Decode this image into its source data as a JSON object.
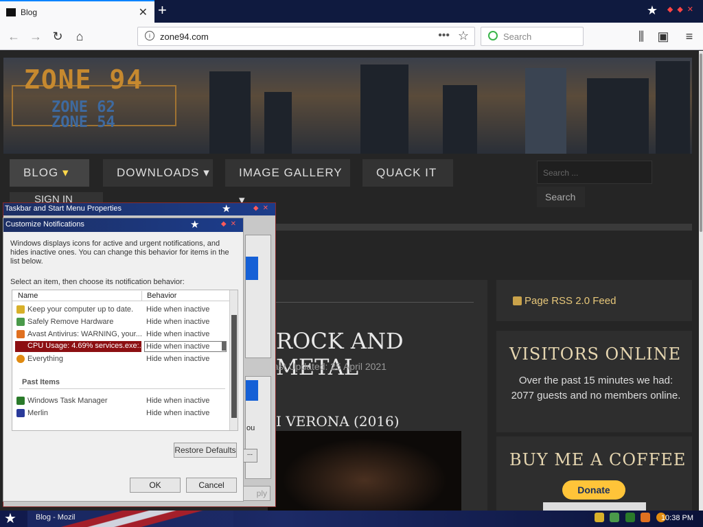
{
  "browser": {
    "tab_title": "Blog",
    "tab_close": "✕",
    "new_tab": "+",
    "url": "zone94.com",
    "page_actions": "•••",
    "search_placeholder": "Search"
  },
  "site": {
    "logo_main": "ZONE 94",
    "logo_sub1": "ZONE 62",
    "logo_sub2": "ZONE 54",
    "nav": [
      {
        "label": "BLOG",
        "caret": true
      },
      {
        "label": "DOWNLOADS",
        "caret": true
      },
      {
        "label": "IMAGE GALLERY",
        "caret": true
      },
      {
        "label": "QUACK IT",
        "caret": false
      }
    ],
    "signin_label": "SIGN IN",
    "search_placeholder": "Search ...",
    "search_button": "Search",
    "main_heading": "ROCK AND METAL",
    "last_updated": "ast Updated: 25 April 2021",
    "post_title": "I VERONA (2016)",
    "rss_label": "Page RSS 2.0 Feed",
    "visitors_title": "VISITORS ONLINE",
    "visitors_text": "Over the past 15 minutes we had: 2077 guests and no members online.",
    "coffee_title": "BUY ME A COFFEE",
    "donate_label": "Donate"
  },
  "outer_dialog": {
    "title": "Taskbar and Start Menu Properties",
    "partial_text": "ou",
    "dots_button": "...",
    "apply_label": "ply"
  },
  "dialog": {
    "title": "Customize Notifications",
    "description": "Windows displays icons for active and urgent notifications, and hides inactive ones. You can change this behavior for items in the list below.",
    "select_label": "Select an item, then choose its notification behavior:",
    "col_name": "Name",
    "col_behavior": "Behavior",
    "current_items": [
      {
        "name": "Keep your computer up to date.",
        "behavior": "Hide when inactive",
        "icon": "shield-icon",
        "color": "#d8b02a"
      },
      {
        "name": "Safely Remove Hardware",
        "behavior": "Hide when inactive",
        "icon": "usb-icon",
        "color": "#4a9a4a"
      },
      {
        "name": "Avast Antivirus: WARNING, your...",
        "behavior": "Hide when inactive",
        "icon": "avast-icon",
        "color": "#e07020"
      },
      {
        "name": "CPU Usage: 4.69% services.exe:...",
        "behavior": "Hide when inactive",
        "icon": "cpu-icon",
        "color": "#8c0f12",
        "selected": true
      },
      {
        "name": "Everything",
        "behavior": "Hide when inactive",
        "icon": "search-icon",
        "color": "#e08a10"
      }
    ],
    "past_label": "Past Items",
    "past_items": [
      {
        "name": "Windows Task Manager",
        "behavior": "Hide when inactive",
        "icon": "taskmanager-icon",
        "color": "#2a7a2a"
      },
      {
        "name": "Merlin",
        "behavior": "Hide when inactive",
        "icon": "merlin-icon",
        "color": "#2a3a9a"
      }
    ],
    "restore_label": "Restore Defaults",
    "ok_label": "OK",
    "cancel_label": "Cancel"
  },
  "taskbar": {
    "task_label": "Blog - Mozil",
    "clock": "10:38 PM"
  }
}
